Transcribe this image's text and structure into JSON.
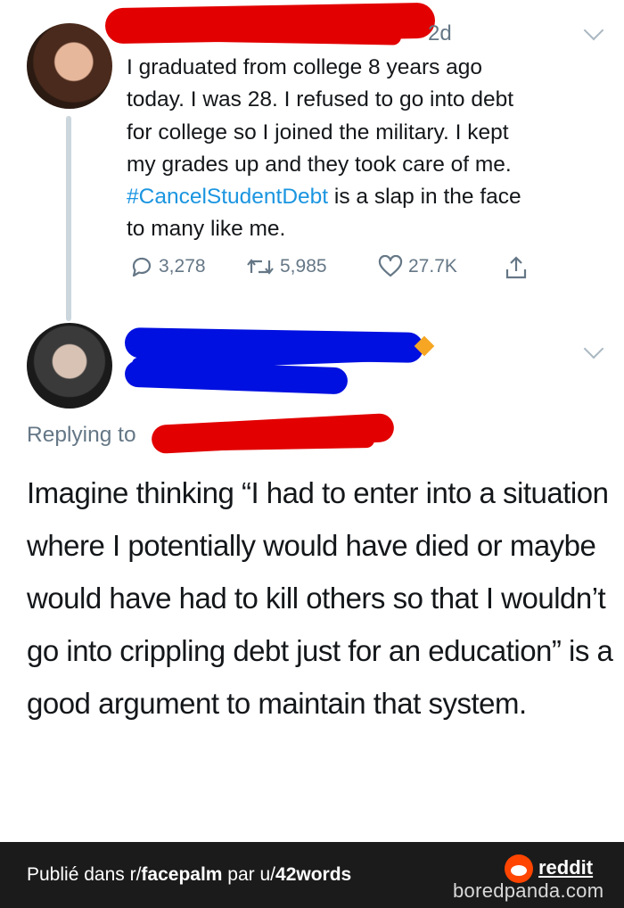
{
  "tweet1": {
    "timestamp": "2d",
    "text_main": "I graduated from college 8 years ago\ntoday. I was 28. I refused to go into debt\nfor college so I joined the military. I kept\nmy grades up and they took care of me.\n",
    "hashtag": "#CancelStudentDebt",
    "text_tail": " is a slap in the face\nto many like me.",
    "replies": "3,278",
    "retweets": "5,985",
    "likes": "27.7K"
  },
  "tweet2": {
    "replying_to": "Replying to",
    "text": "Imagine thinking “I had to enter into a situation where I potentially would have died or maybe would have had to kill others so that I wouldn’t go into crippling debt just for an education” is a good argument to maintain that system."
  },
  "footer": {
    "prefix": "Publié dans r/",
    "subreddit": "facepalm",
    "middle": " par u/",
    "user": "42words",
    "reddit_label": "reddit",
    "watermark": "boredpanda.com"
  },
  "colors": {
    "redaction_red": "#e20000",
    "redaction_blue": "#0010e0",
    "hashtag_blue": "#1b95e0",
    "muted_gray": "#657786",
    "footer_bg": "#1b1b1b",
    "reddit_orange": "#ff4500"
  },
  "icons": {
    "reply": "reply-icon",
    "retweet": "retweet-icon",
    "like": "heart-icon",
    "share": "share-icon",
    "more": "chevron-down-icon"
  }
}
